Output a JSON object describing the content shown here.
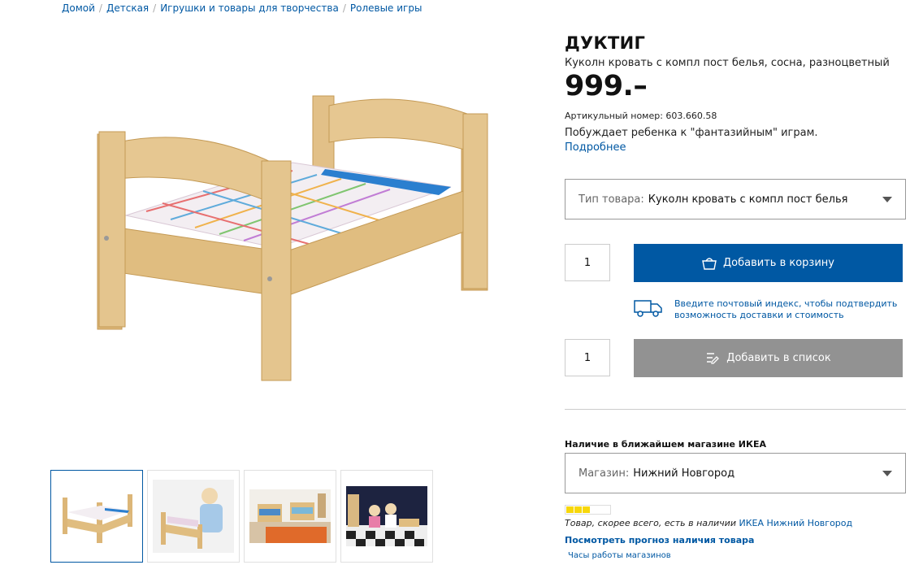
{
  "breadcrumb": [
    "Домой",
    "Детская",
    "Игрушки и товары для творчества",
    "Ролевые игры"
  ],
  "product": {
    "name": "ДУКТИГ",
    "description": "Куколн кровать с компл пост белья, сосна, разноцветный",
    "price": "999.–",
    "article": "Артикульный номер: 603.660.58",
    "summary": "Побуждает ребенка к \"фантазийным\" играм.",
    "more_link": "Подробнее"
  },
  "type_select": {
    "label": "Тип товара:",
    "value": "Куколн кровать с компл пост белья"
  },
  "cart": {
    "quantity": "1",
    "add_label": "Добавить в корзину"
  },
  "delivery": {
    "text": "Введите почтовый индекс, чтобы подтвердить возможность доставки и стоимость"
  },
  "list": {
    "quantity": "1",
    "add_label": "Добавить в список"
  },
  "availability": {
    "title": "Наличие в ближайшем магазине ИКЕА",
    "store_label": "Магазин:",
    "store_value": "Нижний Новгород",
    "stock_level": 0.6,
    "stock_text": "Товар, скорее всего, есть в наличии",
    "store_link": "ИКЕА Нижний Новгород",
    "forecast_link": "Посмотреть прогноз наличия товара",
    "hours_link": "Часы работы магазинов"
  },
  "colors": {
    "ikea_blue": "#0058a3",
    "stock_yellow": "#f7d70a",
    "list_gray": "#929292"
  },
  "icons": [
    "basket-icon",
    "truck-icon",
    "list-add-icon",
    "chevron-down-icon"
  ]
}
